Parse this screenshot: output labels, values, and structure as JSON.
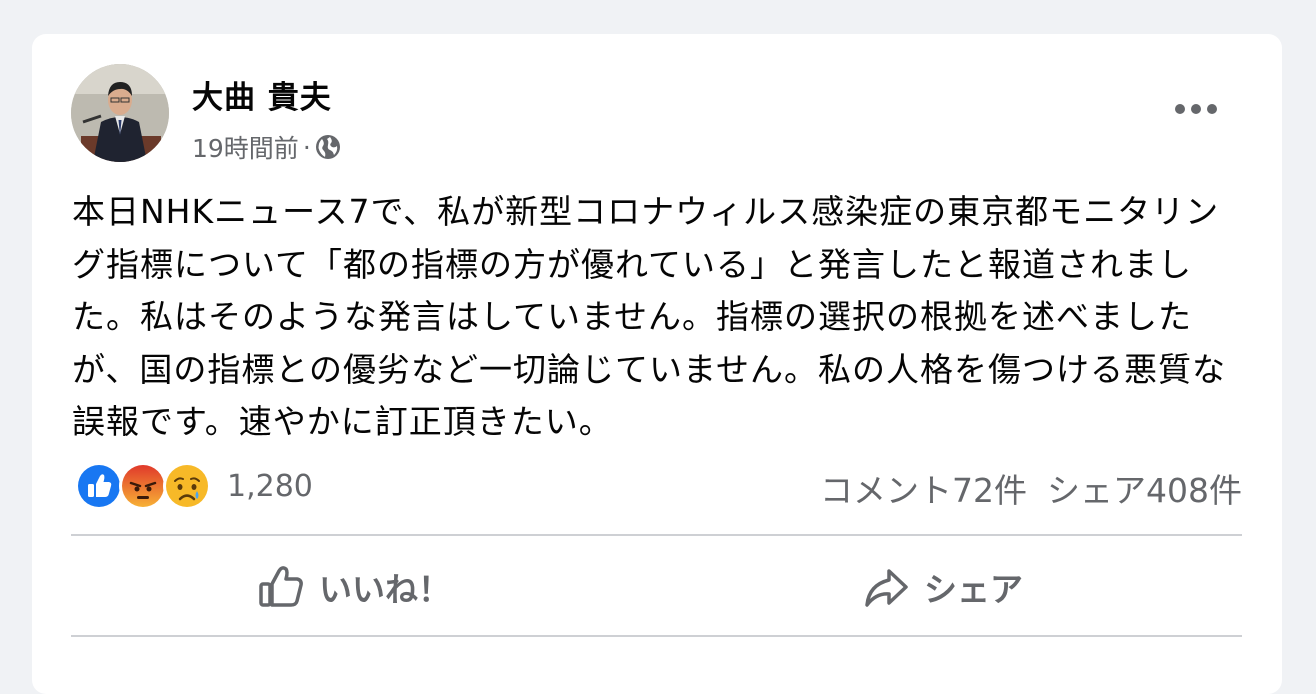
{
  "post": {
    "author": "大曲 貴夫",
    "timestamp": "19時間前",
    "separator": "·",
    "audience_icon": "globe-icon",
    "more_icon": "more-options-icon",
    "text": "本日NHKニュース7で、私が新型コロナウィルス感染症の東京都モニタリング指標について「都の指標の方が優れている」と発言したと報道されました。私はそのような発言はしていません。指標の選択の根拠を述べましたが、国の指標との優劣など一切論じていません。私の人格を傷つける悪質な誤報です。速やかに訂正頂きたい。"
  },
  "reactions": {
    "icons": [
      "like-reaction-icon",
      "angry-reaction-icon",
      "sad-reaction-icon"
    ],
    "count": "1,280"
  },
  "stats": {
    "comments": "コメント72件",
    "shares": "シェア408件"
  },
  "actions": {
    "like_label": "いいね！",
    "share_label": "シェア"
  },
  "colors": {
    "background": "#f0f2f5",
    "card": "#ffffff",
    "secondary_text": "#65676b",
    "like_blue": "#1877f2",
    "angry_orange": "#f0613a",
    "sad_yellow": "#f7b928"
  }
}
